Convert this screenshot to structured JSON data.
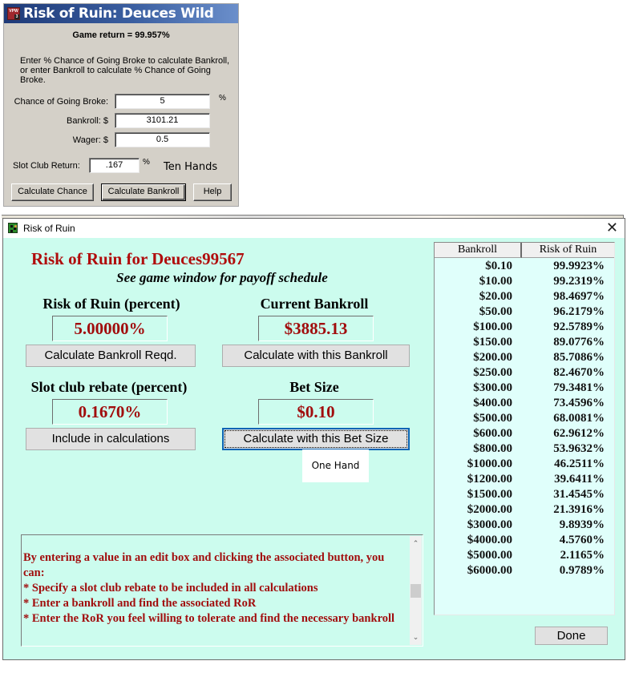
{
  "deuces_dialog": {
    "title": "Risk of Ruin: Deuces Wild",
    "game_return": "Game return = 99.957%",
    "instructions": "Enter % Chance of Going Broke to calculate Bankroll, or enter Bankroll to calculate % Chance of Going Broke.",
    "fields": {
      "chance_label": "Chance of Going Broke:",
      "chance_value": "5",
      "chance_unit": "%",
      "bankroll_label": "Bankroll: $",
      "bankroll_value": "3101.21",
      "wager_label": "Wager: $",
      "wager_value": "0.5",
      "slot_label": "Slot Club Return:",
      "slot_value": ".167",
      "slot_unit": "%"
    },
    "hands_label": "Ten Hands",
    "buttons": {
      "calc_chance": "Calculate Chance",
      "calc_bankroll": "Calculate Bankroll",
      "help": "Help"
    }
  },
  "ror_window": {
    "title": "Risk of Ruin",
    "close_glyph": "✕",
    "main_title": "Risk of Ruin for Deuces99567",
    "subtitle": "See game window for payoff schedule",
    "risk_label": "Risk of Ruin (percent)",
    "risk_value": "5.00000%",
    "calc_bankroll_button": "Calculate Bankroll Reqd.",
    "bankroll_label": "Current Bankroll",
    "bankroll_value": "$3885.13",
    "calc_with_bankroll_button": "Calculate with this Bankroll",
    "rebate_label": "Slot club rebate (percent)",
    "rebate_value": "0.1670%",
    "include_button": "Include in calculations",
    "bet_label": "Bet Size",
    "bet_value": "$0.10",
    "calc_bet_button": "Calculate with this Bet Size",
    "hands_label": "One Hand",
    "message_lines": [
      "By entering a value in an edit box and clicking the associated button, you can:",
      "* Specify a slot club rebate to be included in all calculations",
      "* Enter a bankroll and find the associated RoR",
      "* Enter the RoR you feel willing to tolerate and find the necessary bankroll"
    ],
    "table": {
      "headers": [
        "Bankroll",
        "Risk of Ruin"
      ],
      "rows": [
        [
          "$0.10",
          "99.9923%"
        ],
        [
          "$10.00",
          "99.2319%"
        ],
        [
          "$20.00",
          "98.4697%"
        ],
        [
          "$50.00",
          "96.2179%"
        ],
        [
          "$100.00",
          "92.5789%"
        ],
        [
          "$150.00",
          "89.0776%"
        ],
        [
          "$200.00",
          "85.7086%"
        ],
        [
          "$250.00",
          "82.4670%"
        ],
        [
          "$300.00",
          "79.3481%"
        ],
        [
          "$400.00",
          "73.4596%"
        ],
        [
          "$500.00",
          "68.0081%"
        ],
        [
          "$600.00",
          "62.9612%"
        ],
        [
          "$800.00",
          "53.9632%"
        ],
        [
          "$1000.00",
          "46.2511%"
        ],
        [
          "$1200.00",
          "39.6411%"
        ],
        [
          "$1500.00",
          "31.4545%"
        ],
        [
          "$2000.00",
          "21.3916%"
        ],
        [
          "$3000.00",
          "9.8939%"
        ],
        [
          "$4000.00",
          "4.5760%"
        ],
        [
          "$5000.00",
          "2.1165%"
        ],
        [
          "$6000.00",
          "0.9789%"
        ]
      ]
    },
    "done_button": "Done"
  }
}
